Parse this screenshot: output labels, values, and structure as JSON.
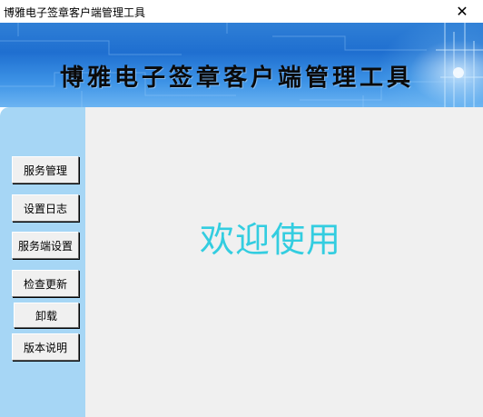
{
  "window": {
    "title": "博雅电子签章客户端管理工具",
    "close_glyph": "✕"
  },
  "banner": {
    "title": "博雅电子签章客户端管理工具"
  },
  "sidebar": {
    "buttons": [
      {
        "label": "服务管理"
      },
      {
        "label": "设置日志"
      },
      {
        "label": "服务端设置"
      },
      {
        "label": "检查更新"
      },
      {
        "label": "卸载"
      },
      {
        "label": "版本说明"
      }
    ]
  },
  "main": {
    "welcome_text": "欢迎使用"
  },
  "colors": {
    "sidebar_bg": "#a6d6f5",
    "content_bg": "#f0f0f0",
    "welcome_text": "#33cde0",
    "banner_blue": "#1f6fd0"
  }
}
